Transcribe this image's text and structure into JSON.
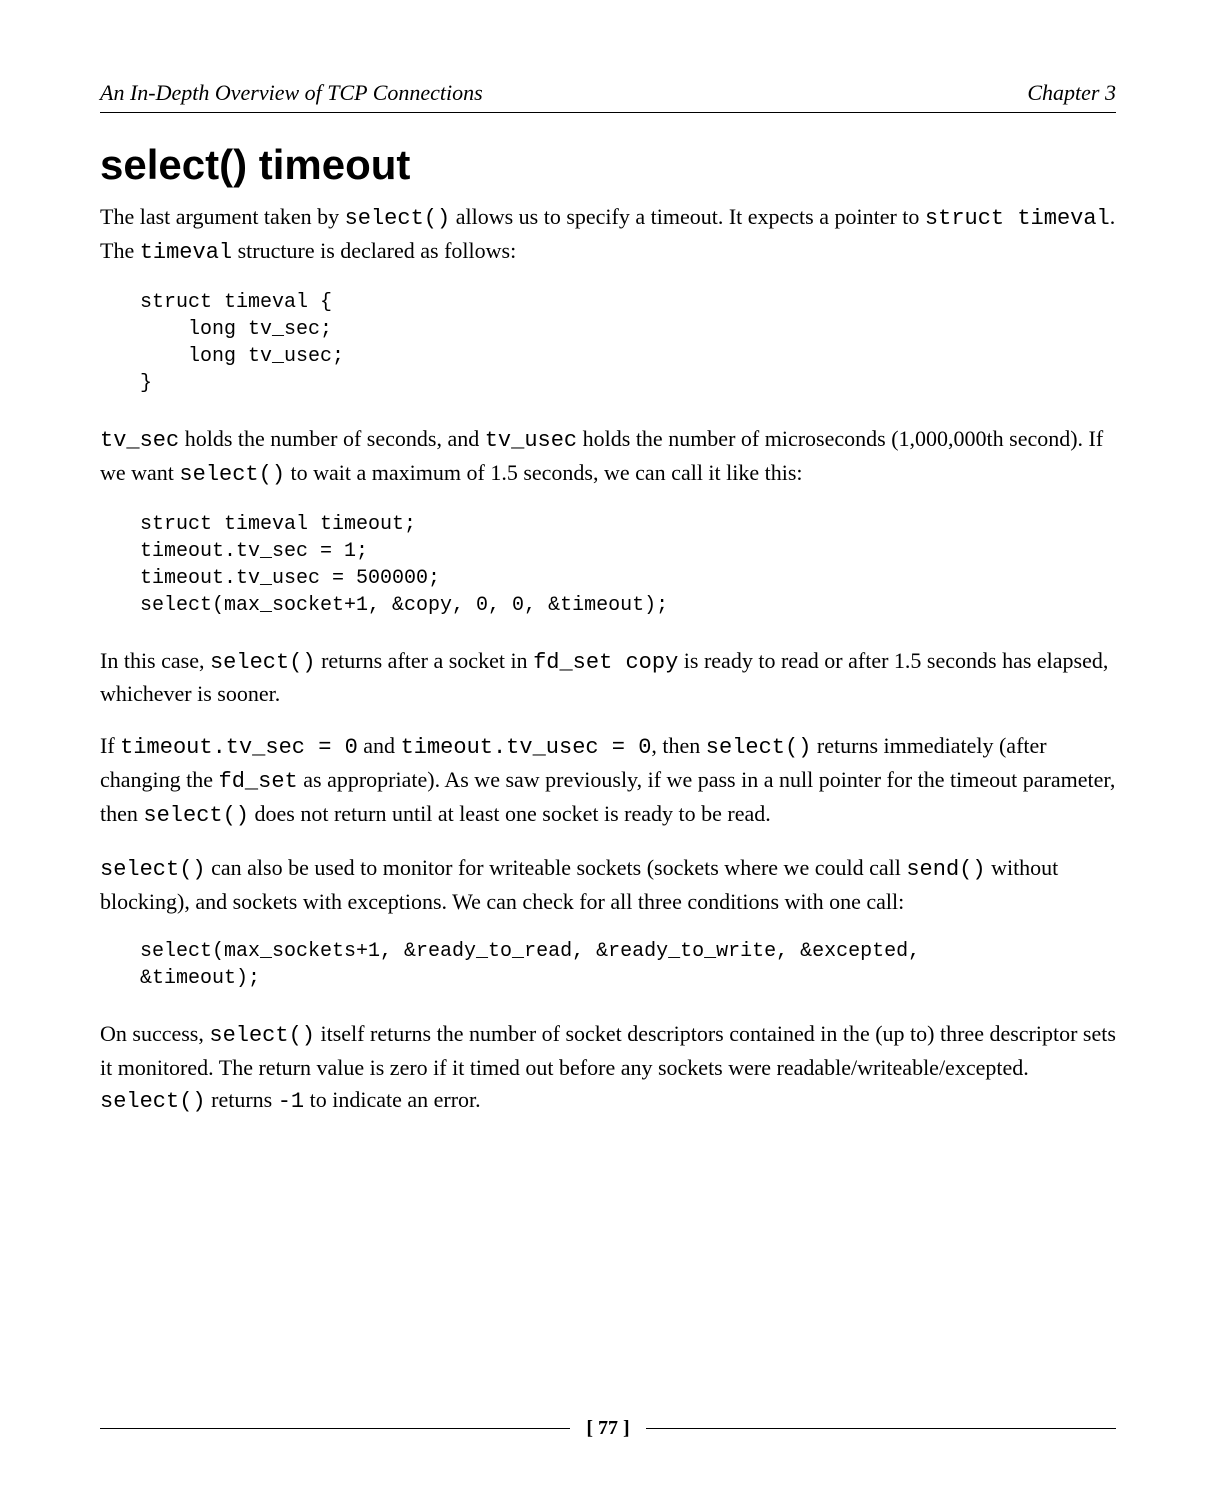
{
  "header": {
    "left": "An In-Depth Overview of TCP Connections",
    "right": "Chapter 3"
  },
  "section_title": "select() timeout",
  "para1": {
    "part1": "The last argument taken by ",
    "code1": "select()",
    "part2": " allows us to specify a timeout. It expects a pointer to ",
    "code2": "struct timeval",
    "part3": ". The ",
    "code3": "timeval",
    "part4": " structure is declared as follows:"
  },
  "code1": "struct timeval {\n    long tv_sec;\n    long tv_usec;\n}",
  "para2": {
    "code1": "tv_sec",
    "part1": " holds the number of seconds, and ",
    "code2": "tv_usec",
    "part2": " holds the number of microseconds (1,000,000th second). If we want ",
    "code3": "select()",
    "part3": " to wait a maximum of 1.5 seconds, we can call it like this:"
  },
  "code2": "struct timeval timeout;\ntimeout.tv_sec = 1;\ntimeout.tv_usec = 500000;\nselect(max_socket+1, &copy, 0, 0, &timeout);",
  "para3": {
    "part1": "In this case, ",
    "code1": "select()",
    "part2": " returns after a socket in ",
    "code2": "fd_set copy",
    "part3": " is ready to read or after 1.5 seconds has elapsed, whichever is sooner."
  },
  "para4": {
    "part1": "If ",
    "code1": "timeout.tv_sec = 0",
    "part2": " and ",
    "code2": "timeout.tv_usec = 0",
    "part3": ", then ",
    "code3": "select()",
    "part4": " returns immediately (after changing the ",
    "code4": "fd_set",
    "part5": " as appropriate). As we saw previously, if we pass in a null pointer for the timeout parameter, then ",
    "code5": "select()",
    "part6": " does not return until at least one socket is ready to be read."
  },
  "para5": {
    "code1": "select()",
    "part1": " can also be used to monitor for writeable sockets (sockets where we could call ",
    "code2": "send()",
    "part2": " without blocking), and sockets with exceptions. We can check for all three conditions with one call:"
  },
  "code3": "select(max_sockets+1, &ready_to_read, &ready_to_write, &excepted,\n&timeout);",
  "para6": {
    "part1": "On success, ",
    "code1": "select()",
    "part2": " itself returns the number of socket descriptors contained in the (up to) three descriptor sets it monitored. The return value is zero if it timed out before any sockets were readable/writeable/excepted. ",
    "code2": "select()",
    "part3": " returns ",
    "code3": "-1",
    "part4": " to indicate an error."
  },
  "footer": {
    "page": "[ 77 ]"
  }
}
